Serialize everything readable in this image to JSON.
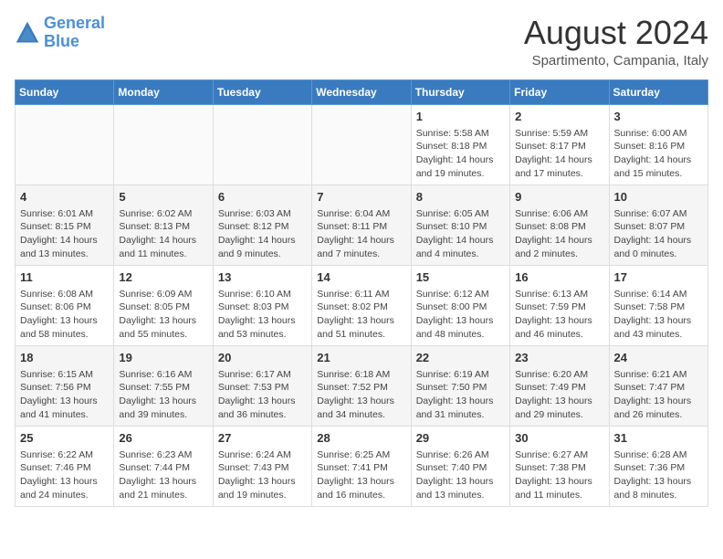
{
  "header": {
    "logo_line1": "General",
    "logo_line2": "Blue",
    "main_title": "August 2024",
    "subtitle": "Spartimento, Campania, Italy"
  },
  "days_of_week": [
    "Sunday",
    "Monday",
    "Tuesday",
    "Wednesday",
    "Thursday",
    "Friday",
    "Saturday"
  ],
  "weeks": [
    [
      {
        "day": "",
        "info": ""
      },
      {
        "day": "",
        "info": ""
      },
      {
        "day": "",
        "info": ""
      },
      {
        "day": "",
        "info": ""
      },
      {
        "day": "1",
        "info": "Sunrise: 5:58 AM\nSunset: 8:18 PM\nDaylight: 14 hours\nand 19 minutes."
      },
      {
        "day": "2",
        "info": "Sunrise: 5:59 AM\nSunset: 8:17 PM\nDaylight: 14 hours\nand 17 minutes."
      },
      {
        "day": "3",
        "info": "Sunrise: 6:00 AM\nSunset: 8:16 PM\nDaylight: 14 hours\nand 15 minutes."
      }
    ],
    [
      {
        "day": "4",
        "info": "Sunrise: 6:01 AM\nSunset: 8:15 PM\nDaylight: 14 hours\nand 13 minutes."
      },
      {
        "day": "5",
        "info": "Sunrise: 6:02 AM\nSunset: 8:13 PM\nDaylight: 14 hours\nand 11 minutes."
      },
      {
        "day": "6",
        "info": "Sunrise: 6:03 AM\nSunset: 8:12 PM\nDaylight: 14 hours\nand 9 minutes."
      },
      {
        "day": "7",
        "info": "Sunrise: 6:04 AM\nSunset: 8:11 PM\nDaylight: 14 hours\nand 7 minutes."
      },
      {
        "day": "8",
        "info": "Sunrise: 6:05 AM\nSunset: 8:10 PM\nDaylight: 14 hours\nand 4 minutes."
      },
      {
        "day": "9",
        "info": "Sunrise: 6:06 AM\nSunset: 8:08 PM\nDaylight: 14 hours\nand 2 minutes."
      },
      {
        "day": "10",
        "info": "Sunrise: 6:07 AM\nSunset: 8:07 PM\nDaylight: 14 hours\nand 0 minutes."
      }
    ],
    [
      {
        "day": "11",
        "info": "Sunrise: 6:08 AM\nSunset: 8:06 PM\nDaylight: 13 hours\nand 58 minutes."
      },
      {
        "day": "12",
        "info": "Sunrise: 6:09 AM\nSunset: 8:05 PM\nDaylight: 13 hours\nand 55 minutes."
      },
      {
        "day": "13",
        "info": "Sunrise: 6:10 AM\nSunset: 8:03 PM\nDaylight: 13 hours\nand 53 minutes."
      },
      {
        "day": "14",
        "info": "Sunrise: 6:11 AM\nSunset: 8:02 PM\nDaylight: 13 hours\nand 51 minutes."
      },
      {
        "day": "15",
        "info": "Sunrise: 6:12 AM\nSunset: 8:00 PM\nDaylight: 13 hours\nand 48 minutes."
      },
      {
        "day": "16",
        "info": "Sunrise: 6:13 AM\nSunset: 7:59 PM\nDaylight: 13 hours\nand 46 minutes."
      },
      {
        "day": "17",
        "info": "Sunrise: 6:14 AM\nSunset: 7:58 PM\nDaylight: 13 hours\nand 43 minutes."
      }
    ],
    [
      {
        "day": "18",
        "info": "Sunrise: 6:15 AM\nSunset: 7:56 PM\nDaylight: 13 hours\nand 41 minutes."
      },
      {
        "day": "19",
        "info": "Sunrise: 6:16 AM\nSunset: 7:55 PM\nDaylight: 13 hours\nand 39 minutes."
      },
      {
        "day": "20",
        "info": "Sunrise: 6:17 AM\nSunset: 7:53 PM\nDaylight: 13 hours\nand 36 minutes."
      },
      {
        "day": "21",
        "info": "Sunrise: 6:18 AM\nSunset: 7:52 PM\nDaylight: 13 hours\nand 34 minutes."
      },
      {
        "day": "22",
        "info": "Sunrise: 6:19 AM\nSunset: 7:50 PM\nDaylight: 13 hours\nand 31 minutes."
      },
      {
        "day": "23",
        "info": "Sunrise: 6:20 AM\nSunset: 7:49 PM\nDaylight: 13 hours\nand 29 minutes."
      },
      {
        "day": "24",
        "info": "Sunrise: 6:21 AM\nSunset: 7:47 PM\nDaylight: 13 hours\nand 26 minutes."
      }
    ],
    [
      {
        "day": "25",
        "info": "Sunrise: 6:22 AM\nSunset: 7:46 PM\nDaylight: 13 hours\nand 24 minutes."
      },
      {
        "day": "26",
        "info": "Sunrise: 6:23 AM\nSunset: 7:44 PM\nDaylight: 13 hours\nand 21 minutes."
      },
      {
        "day": "27",
        "info": "Sunrise: 6:24 AM\nSunset: 7:43 PM\nDaylight: 13 hours\nand 19 minutes."
      },
      {
        "day": "28",
        "info": "Sunrise: 6:25 AM\nSunset: 7:41 PM\nDaylight: 13 hours\nand 16 minutes."
      },
      {
        "day": "29",
        "info": "Sunrise: 6:26 AM\nSunset: 7:40 PM\nDaylight: 13 hours\nand 13 minutes."
      },
      {
        "day": "30",
        "info": "Sunrise: 6:27 AM\nSunset: 7:38 PM\nDaylight: 13 hours\nand 11 minutes."
      },
      {
        "day": "31",
        "info": "Sunrise: 6:28 AM\nSunset: 7:36 PM\nDaylight: 13 hours\nand 8 minutes."
      }
    ]
  ]
}
